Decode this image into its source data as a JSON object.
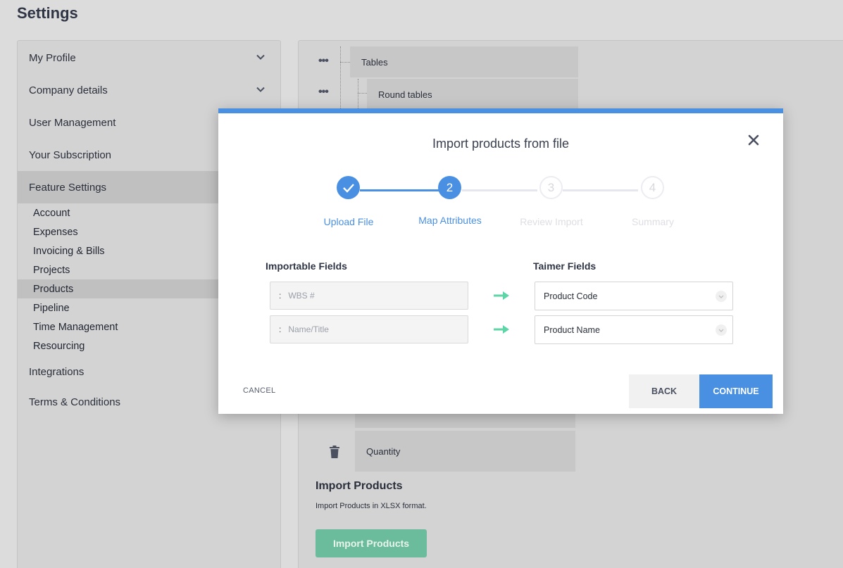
{
  "page_title": "Settings",
  "sidebar": {
    "items": [
      {
        "label": "My Profile"
      },
      {
        "label": "Company details"
      },
      {
        "label": "User Management"
      },
      {
        "label": "Your Subscription"
      },
      {
        "label": "Feature Settings"
      },
      {
        "label": "Integrations"
      },
      {
        "label": "Terms & Conditions"
      }
    ],
    "sub_items": [
      {
        "label": "Account"
      },
      {
        "label": "Expenses"
      },
      {
        "label": "Invoicing & Bills"
      },
      {
        "label": "Projects"
      },
      {
        "label": "Products"
      },
      {
        "label": "Pipeline"
      },
      {
        "label": "Time Management"
      },
      {
        "label": "Resourcing"
      }
    ]
  },
  "content": {
    "tree": [
      {
        "label": "Tables"
      },
      {
        "label": "Round tables"
      },
      {
        "label": "Quantity"
      }
    ],
    "import_section": {
      "title": "Import Products",
      "description": "Import Products in XLSX format.",
      "button_label": "Import Products"
    }
  },
  "modal": {
    "title": "Import products from file",
    "steps": [
      {
        "label": "Upload File",
        "number": "",
        "state": "done"
      },
      {
        "label": "Map Attributes",
        "number": "2",
        "state": "active"
      },
      {
        "label": "Review Import",
        "number": "3",
        "state": "pending"
      },
      {
        "label": "Summary",
        "number": "4",
        "state": "pending"
      }
    ],
    "importable_header": "Importable Fields",
    "taimer_header": "Taimer Fields",
    "rows": [
      {
        "colon": ":",
        "importable": "WBS #",
        "taimer": "Product Code"
      },
      {
        "colon": ":",
        "importable": "Name/Title",
        "taimer": "Product Name"
      }
    ],
    "cancel_label": "CANCEL",
    "back_label": "BACK",
    "continue_label": "CONTINUE"
  },
  "colors": {
    "accent": "#4a90e2",
    "import_button": "#6bbc9c",
    "arrow": "#5cd6a6"
  }
}
